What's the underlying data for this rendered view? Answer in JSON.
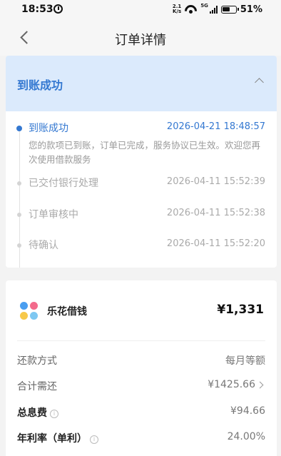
{
  "status_bar": {
    "time": "18:53",
    "network_speed_top": "2.1",
    "network_speed_bottom": "K/s",
    "network_type": "5G",
    "battery": "51%"
  },
  "nav": {
    "title": "订单详情"
  },
  "status": {
    "title": "到账成功",
    "timeline": [
      {
        "label": "到账成功",
        "time": "2026-04-21 18:48:57",
        "active": true,
        "description": "您的款项已到账，订单已完成，服务协议已生效。欢迎您再次使用借款服务"
      },
      {
        "label": "已交付银行处理",
        "time": "2026-04-11 15:52:39",
        "active": false
      },
      {
        "label": "订单审核中",
        "time": "2026-04-11 15:52:38",
        "active": false
      },
      {
        "label": "待确认",
        "time": "2026-04-11 15:52:20",
        "active": false
      }
    ]
  },
  "product": {
    "name": "乐花借钱",
    "amount": "¥1,331",
    "logo_colors": [
      "#4a9ef0",
      "#f36b8c",
      "#f7c84a",
      "#7ec8f2"
    ]
  },
  "details": [
    {
      "label": "还款方式",
      "value": "每月等额"
    },
    {
      "label": "合计需还",
      "value": "¥1425.66"
    },
    {
      "label": "总息费",
      "value": "¥94.66"
    },
    {
      "label": "年利率（单利）",
      "value": "24.00%"
    }
  ],
  "colors": {
    "accent": "#3478d1",
    "header_bg": "#dbeafc"
  }
}
